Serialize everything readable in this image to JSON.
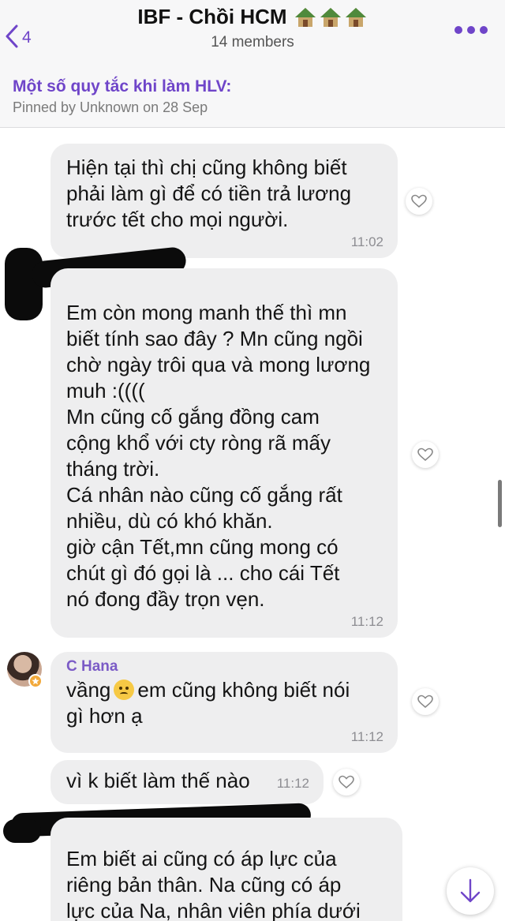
{
  "header": {
    "back_count": "4",
    "title": "IBF - Chồi HCM",
    "members": "14 members",
    "accent": "#6f45c9"
  },
  "pinned": {
    "title": "Một số quy tắc khi làm HLV:",
    "subtitle": "Pinned by Unknown on 28 Sep"
  },
  "messages": [
    {
      "text": "Hiện tại thì chị cũng không biết\nphải làm gì để có tiền trả lương\ntrước tết cho mọi người.",
      "time": "11:02"
    },
    {
      "text": "Em còn mong manh thế thì mn\nbiết tính sao đây ? Mn cũng ngồi\nchờ ngày trôi qua và mong lương\nmuh :((((\nMn cũng cố gắng đồng cam\ncộng khổ với cty ròng rã mấy\ntháng trời.\nCá nhân nào cũng cố gắng rất\nnhiều, dù có khó khăn.\ngiờ cận Tết,mn cũng mong có\nchút gì đó gọi là ... cho cái Tết\nnó đong đầy trọn vẹn.",
      "time": "11:12"
    },
    {
      "sender": "C Hana",
      "text_a": "vầng",
      "text_b": "em cũng không biết nói",
      "text_c": "gì hơn ạ",
      "time": "11:12"
    },
    {
      "text": "vì k biết làm thế nào",
      "time": "11:12"
    },
    {
      "text": "Em biết ai cũng có áp lực của\nriêng bản thân. Na cũng có áp\nlực của Na, nhân viên phía dưới"
    }
  ]
}
